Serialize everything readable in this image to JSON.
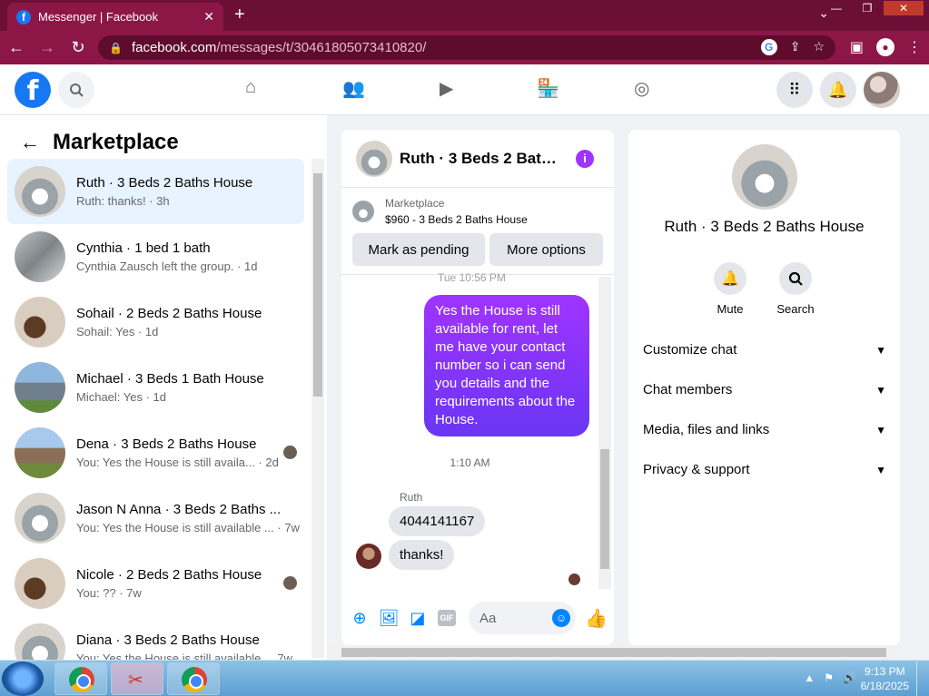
{
  "browser": {
    "tab_title": "Messenger | Facebook",
    "url_host": "facebook.com",
    "url_path": "/messages/t/30461805073410820/",
    "new_tab": "+",
    "dropdown": "⌄",
    "win_min": "—",
    "win_max": "❐",
    "win_close": "✕"
  },
  "sidebar": {
    "title": "Marketplace",
    "conversations": [
      {
        "name": "Ruth · 3 Beds 2 Baths House",
        "preview": "Ruth: thanks! · 3h"
      },
      {
        "name": "Cynthia · 1 bed 1 bath",
        "preview": "Cynthia Zausch left the group. · 1d"
      },
      {
        "name": "Sohail · 2 Beds 2 Baths House",
        "preview": "Sohail: Yes · 1d"
      },
      {
        "name": "Michael · 3 Beds 1 Bath House",
        "preview": "Michael: Yes · 1d"
      },
      {
        "name": "Dena · 3 Beds 2 Baths House",
        "preview": "You: Yes the House is still availa... · 2d"
      },
      {
        "name": "Jason N Anna · 3 Beds 2 Baths ...",
        "preview": "You: Yes the House is still available ... · 7w"
      },
      {
        "name": "Nicole · 2 Beds 2 Baths House",
        "preview": "You: ?? · 7w"
      },
      {
        "name": "Diana · 3 Beds 2 Baths House",
        "preview": "You: Yes the House is still available ... 7w"
      }
    ]
  },
  "chat": {
    "title": "Ruth · 3 Beds 2 Bath...",
    "listing_source": "Marketplace",
    "listing_price": "$960 - 3 Beds 2 Baths House",
    "btn_pending": "Mark as pending",
    "btn_more": "More options",
    "faded_ts": "Tue 10:56 PM",
    "outgoing": "Yes the House is still available for rent, let me have your contact number so i can send you details and the requirements about the House.",
    "timestamp": "1:10 AM",
    "sender": "Ruth",
    "incoming_1": "4044141167",
    "incoming_2": "thanks!",
    "composer_placeholder": "Aa",
    "gif_label": "GIF"
  },
  "details": {
    "name": "Ruth · 3 Beds 2 Baths House",
    "mute_label": "Mute",
    "search_label": "Search",
    "sections": [
      "Customize chat",
      "Chat members",
      "Media, files and links",
      "Privacy & support"
    ]
  },
  "taskbar": {
    "time": "9:13 PM",
    "date": "6/18/2025"
  },
  "colors": {
    "chrome_accent": "#8c1747",
    "messenger_bubble": "#a033ff",
    "facebook_blue": "#1877f2"
  }
}
